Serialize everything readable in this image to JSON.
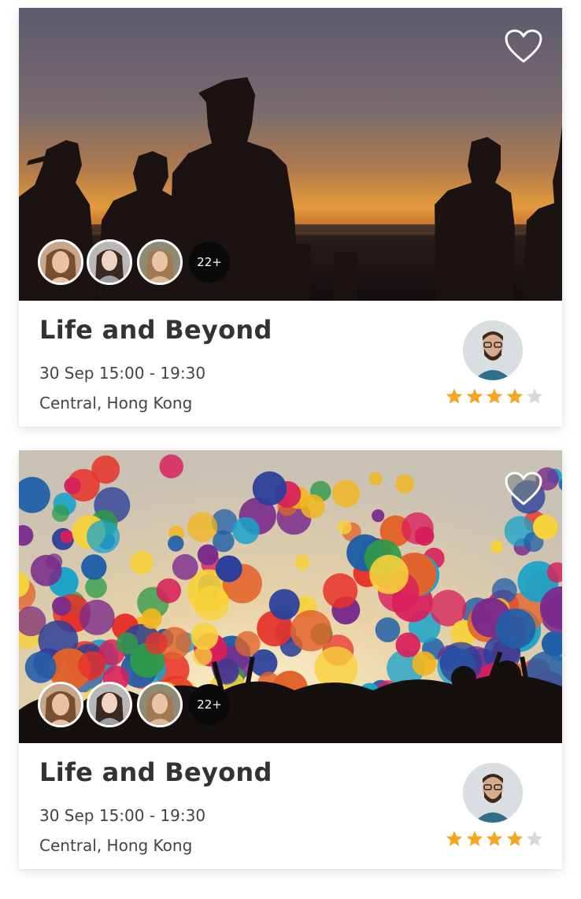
{
  "events": [
    {
      "title": "Life and Beyond",
      "date": "30 Sep 15:00 - 19:30",
      "location": "Central, Hong Kong",
      "attendee_more": "22+",
      "rating": 4,
      "rating_max": 5,
      "favorite_icon": "heart-outline-icon",
      "image": "sunset-silhouettes"
    },
    {
      "title": "Life and Beyond",
      "date": "30 Sep 15:00 - 19:30",
      "location": "Central, Hong Kong",
      "attendee_more": "22+",
      "rating": 4,
      "rating_max": 5,
      "favorite_icon": "heart-outline-icon",
      "image": "colorful-balloons"
    }
  ],
  "colors": {
    "star_filled": "#F5A623",
    "star_empty": "#D8D8D8",
    "title": "#333333",
    "badge": "#0A0A0A"
  }
}
